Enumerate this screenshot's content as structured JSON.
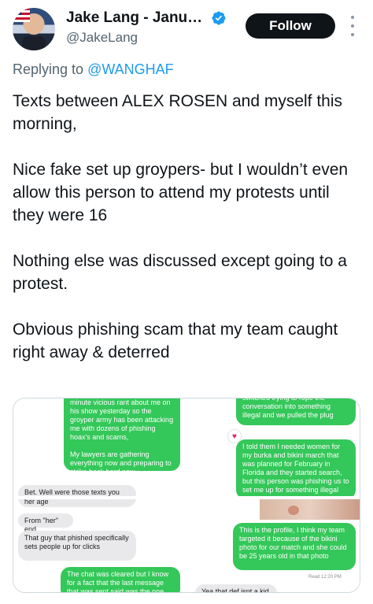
{
  "header": {
    "display_name": "Jake Lang - Janua…",
    "handle": "@JakeLang",
    "follow_label": "Follow"
  },
  "reply": {
    "prefix": "Replying to ",
    "mention": "@WANGHAF"
  },
  "tweet": {
    "paragraphs": [
      "Texts between ALEX ROSEN and myself this morning,",
      "Nice fake set up groypers- but I wouldn’t even allow this person to attend my protests until they were 16",
      "Nothing else was discussed except going to a protest.",
      "Obvious phishing scam that my team caught right away & deterred"
    ]
  },
  "media": {
    "panel1": {
      "green_text": "minute vicious rant about me on his show yesterday so the groyper army has been attacking me with dozens of phishing hoax's and scams,\n\nMy lawyers are gathering everything now and preparing to strike back hard now",
      "gray_text": "Bet. Well were those texts you"
    },
    "panel2": {
      "green_top_text": "switched trying to rope the conversation into something illegal and we pulled the plug",
      "green_text": "I told them I needed women for my burka and bikini march that was planned for February in Florida and they started search, but this person was phishing us to set me up for something illegal"
    },
    "panel3": {
      "gray_top_text": "her age",
      "gray_from_text": "From \"her\" end.",
      "gray_phish_text": "That guy that phished specifically sets people up for clicks",
      "green_text": "The chat was cleared but I know for a fact that the last message that was sent said was the one"
    },
    "panel4": {
      "green_text": "This is the profile, I think my team targeted it because of the bikini photo for our match and she could be 25 years old in that photo",
      "read_receipt": "Read 12:20 PM",
      "gray_text": "Yea that def isnt a kid"
    }
  },
  "colors": {
    "accent": "#1d9bf0",
    "imessage_green": "#34c759",
    "imessage_gray": "#e9e9eb"
  },
  "icons": [
    "verified-badge-icon",
    "more-options-icon",
    "heart-reaction-icon"
  ]
}
